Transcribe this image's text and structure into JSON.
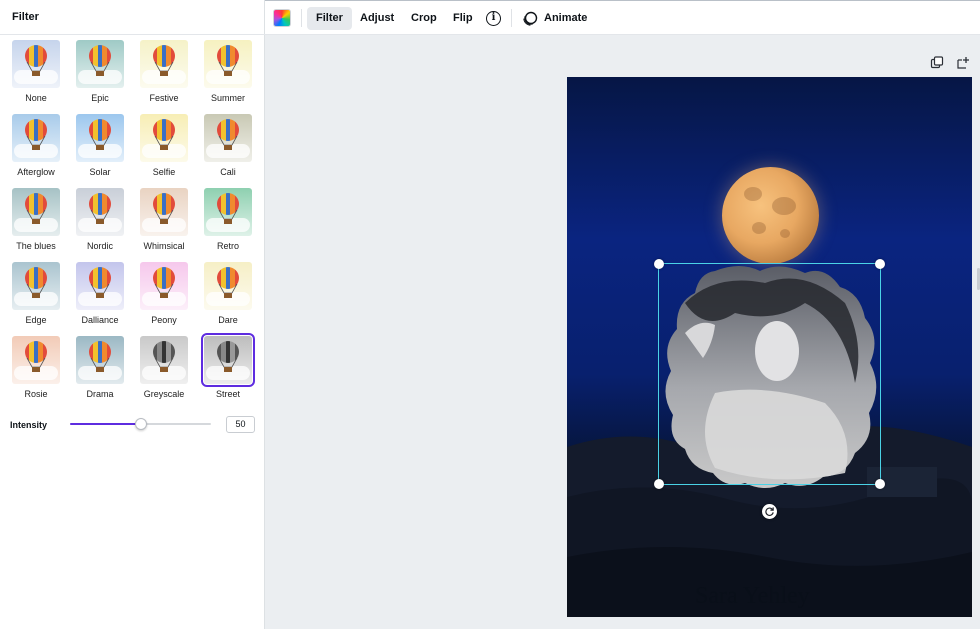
{
  "panel": {
    "title": "Filter",
    "filters": [
      {
        "label": "None",
        "bg": "#c6d4ec",
        "selected": false
      },
      {
        "label": "Epic",
        "bg": "#9fcac6",
        "selected": false
      },
      {
        "label": "Festive",
        "bg": "#f5f2c8",
        "selected": false
      },
      {
        "label": "Summer",
        "bg": "#f6f1c0",
        "selected": false
      },
      {
        "label": "Afterglow",
        "bg": "#a8cbea",
        "selected": false
      },
      {
        "label": "Solar",
        "bg": "#9cc7ee",
        "selected": false
      },
      {
        "label": "Selfie",
        "bg": "#f7eeb5",
        "selected": false
      },
      {
        "label": "Cali",
        "bg": "#c9c9b4",
        "selected": false
      },
      {
        "label": "The blues",
        "bg": "#a6c2c5",
        "selected": false
      },
      {
        "label": "Nordic",
        "bg": "#c9cfd8",
        "selected": false
      },
      {
        "label": "Whimsical",
        "bg": "#e9d3c2",
        "selected": false
      },
      {
        "label": "Retro",
        "bg": "#8ed0b0",
        "selected": false
      },
      {
        "label": "Edge",
        "bg": "#aac4cf",
        "selected": false
      },
      {
        "label": "Dalliance",
        "bg": "#c3c5ec",
        "selected": false
      },
      {
        "label": "Peony",
        "bg": "#f6c8ec",
        "selected": false
      },
      {
        "label": "Dare",
        "bg": "#f6efc6",
        "selected": false
      },
      {
        "label": "Rosie",
        "bg": "#f2cbb7",
        "selected": false
      },
      {
        "label": "Drama",
        "bg": "#9bb8c4",
        "selected": false
      },
      {
        "label": "Greyscale",
        "bg": "#c9c9c9",
        "selected": false
      },
      {
        "label": "Street",
        "bg": "#bdbdbd",
        "selected": true
      }
    ],
    "intensity": {
      "label": "Intensity",
      "value": "50",
      "fraction": 0.5
    }
  },
  "toolbar": {
    "filter": "Filter",
    "adjust": "Adjust",
    "crop": "Crop",
    "flip": "Flip",
    "info": "i",
    "animate": "Animate"
  },
  "design": {
    "watermark": "Sara Yehley"
  },
  "colors": {
    "accent": "#5e2ce0",
    "selection": "#4ad2e6"
  }
}
